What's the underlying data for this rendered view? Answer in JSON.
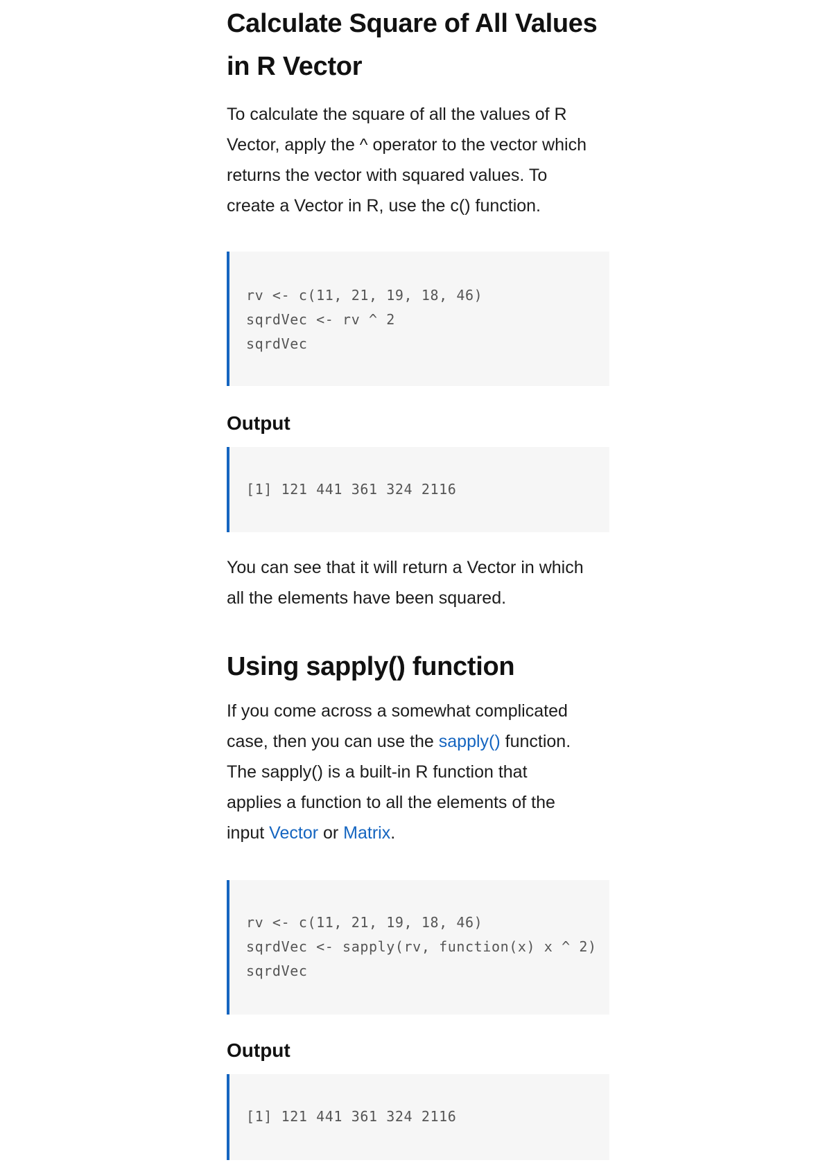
{
  "section1": {
    "title_line1": "Calculate Square of All Values",
    "title_line2": "in R Vector",
    "para": [
      "To calculate the square of all the values of R",
      "Vector, apply the ^ operator to the vector which",
      "returns the vector with squared values. To",
      "create a Vector in R, use the c() function."
    ],
    "code": [
      "rv <- c(11, 21, 19, 18, 46)",
      "sqrdVec <- rv ^ 2",
      "sqrdVec"
    ],
    "output_label": "Output",
    "output": "[1] 121 441 361 324 2116",
    "after_para": [
      "You can see that it will return a Vector in which",
      "all the elements have been squared."
    ]
  },
  "section2": {
    "title": "Using sapply() function",
    "para_line1": "If you come across a somewhat complicated",
    "para_line2_before": "case, then you can use the ",
    "para_line2_link": "sapply()",
    "para_line2_after": " function.",
    "para_line3": "The sapply() is a built-in R function that",
    "para_line4": "applies a function to all the elements of the",
    "para_line5_before": "input ",
    "para_line5_link1": "Vector",
    "para_line5_mid": " or ",
    "para_line5_link2": "Matrix",
    "para_line5_after": ".",
    "code": [
      "rv <- c(11, 21, 19, 18, 46)",
      "sqrdVec <- sapply(rv, function(x) x ^ 2)",
      "sqrdVec"
    ],
    "output_label": "Output",
    "output": "[1] 121 441 361 324 2116"
  },
  "colors": {
    "link": "#1565c0",
    "code_border": "#1565c0",
    "code_bg": "#f6f6f6"
  }
}
